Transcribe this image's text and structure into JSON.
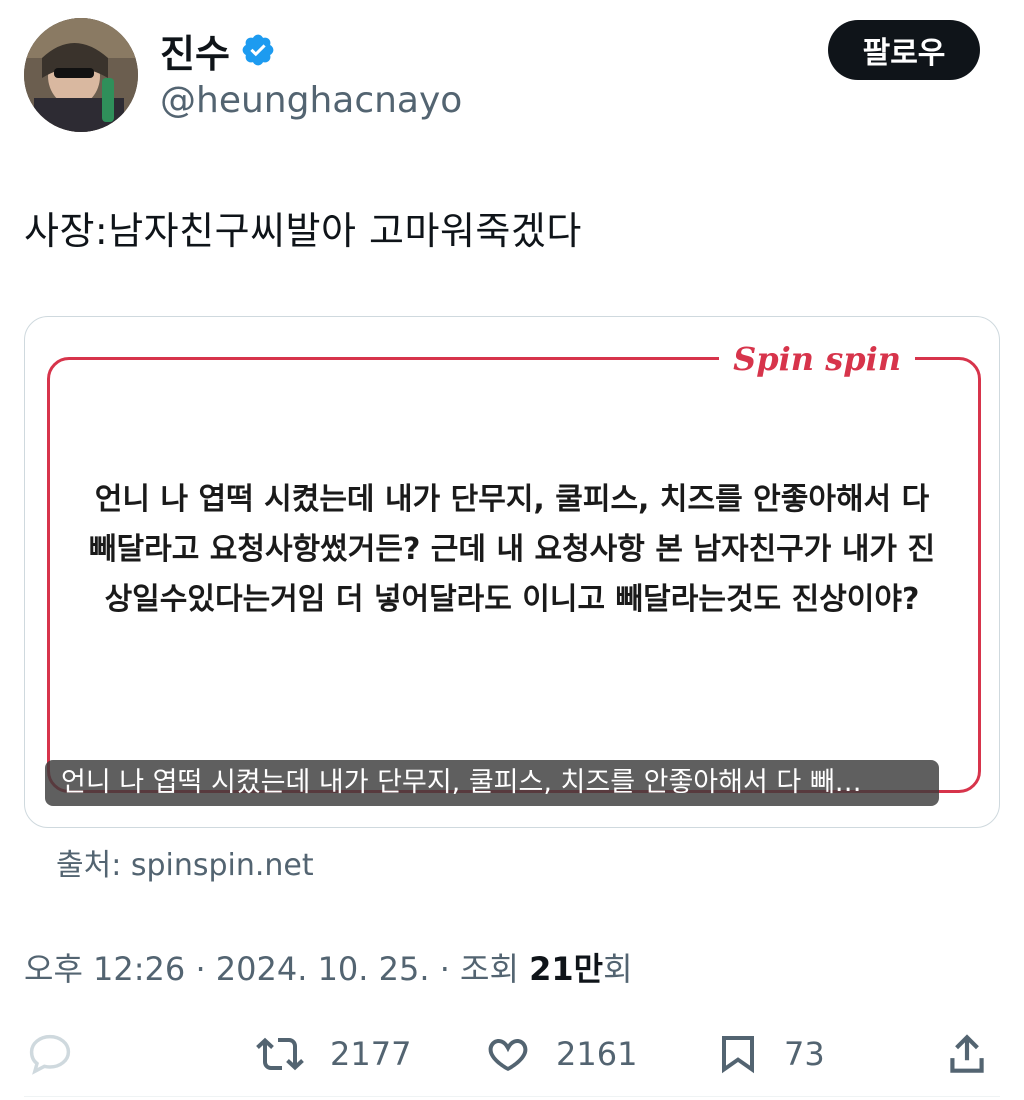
{
  "author": {
    "display_name": "진수",
    "handle": "@heunghacnayo",
    "verified": true
  },
  "follow_button": {
    "label": "팔로우"
  },
  "tweet": {
    "text": "사장:남자친구씨발아 고마워죽겠다"
  },
  "card": {
    "brand": "Spin spin",
    "body": "언니 나 엽떡 시켰는데 내가 단무지, 쿨피스, 치즈를 안좋아해서 다 빼달라고 요청사항썼거든? 근데 내 요청사항 본 남자친구가 내가 진상일수있다는거임 더 넣어달라도 이니고 빼달라는것도 진상이야?",
    "caption": "언니 나 엽떡 시켰는데 내가 단무지, 쿨피스, 치즈를 안좋아해서 다 빼…",
    "source": "출처: spinspin.net"
  },
  "meta": {
    "time": "오후 12:26 · 2024. 10. 25. · 조회 ",
    "views": "21만",
    "views_suffix": "회"
  },
  "actions": {
    "retweets": "2177",
    "likes": "2161",
    "bookmarks": "73"
  },
  "colors": {
    "text": "#0f1419",
    "secondary": "#536471",
    "verified": "#1d9bf0",
    "brand": "#d7344b",
    "button_bg": "#0f1419"
  },
  "icons": [
    "verified-badge-icon",
    "reply-icon",
    "retweet-icon",
    "like-icon",
    "bookmark-icon",
    "share-icon"
  ]
}
